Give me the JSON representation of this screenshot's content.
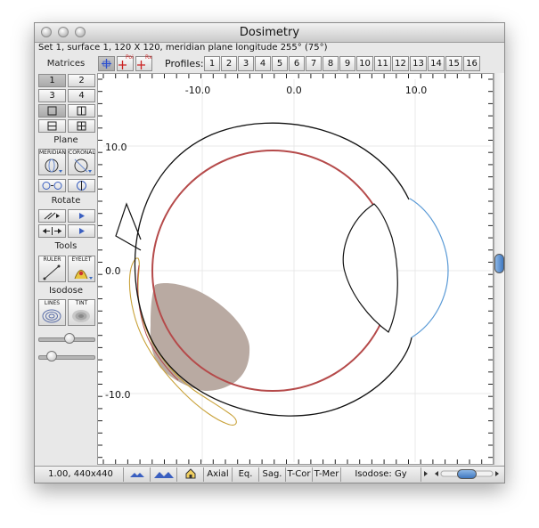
{
  "window": {
    "title": "Dosimetry",
    "subtitle": "Set 1, surface 1, 120 X 120, meridian plane longitude 255° (75°)"
  },
  "toolbar": {
    "poi_label": "Poi",
    "rx_label": "Rx",
    "profiles_label": "Profiles:",
    "profiles": [
      "1",
      "2",
      "3",
      "4",
      "5",
      "6",
      "7",
      "8",
      "9",
      "10",
      "11",
      "12",
      "13",
      "14",
      "15",
      "16"
    ]
  },
  "sidebar": {
    "matrices_label": "Matrices",
    "matrix_buttons": [
      "1",
      "2",
      "3",
      "4"
    ],
    "plane_label": "Plane",
    "meridian_label": "MERIDIAN",
    "coronal_label": "CORONAL",
    "rotate_label": "Rotate",
    "tools_label": "Tools",
    "ruler_label": "RULER",
    "eyelet_label": "EYELET",
    "isodose_label": "Isodose",
    "lines_label": "LINES",
    "tint_label": "TINT",
    "slider1_level": 0.55,
    "slider2_level": 0.15
  },
  "plot": {
    "x_ticks": [
      "-10.0",
      "0.0",
      "10.0"
    ],
    "y_ticks": [
      "10.0",
      "0.0",
      "-10.0"
    ],
    "colors": {
      "retina": "#b54a4a",
      "cornea": "#5a9ad6",
      "plaque": "#c9a23a",
      "dose": "#b9aaa2"
    }
  },
  "statusbar": {
    "zoom": "1.00, 440x440",
    "axial": "Axial",
    "eq": "Eq.",
    "sag": "Sag.",
    "tcor": "T-Cor",
    "tmer": "T-Mer",
    "isodose": "Isodose: Gy"
  },
  "scroll": {
    "vertical_level": 0.5,
    "horizontal_level": 0.5
  }
}
